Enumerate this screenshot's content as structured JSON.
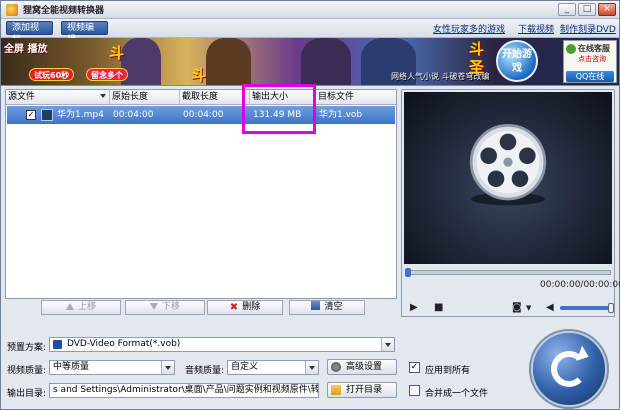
{
  "window": {
    "title": "狸窝全能视频转换器",
    "min_label": "_",
    "max_label": "□",
    "close_label": "×"
  },
  "menu": {
    "add_video": "添加视频",
    "edit_video": "视频编辑",
    "links": [
      "女性玩家多的游戏",
      "下载视频",
      "制作刻录DVD"
    ]
  },
  "banner": {
    "left_text": "全屏 播放",
    "pill1": "试玩60秒",
    "pill2": "留念多个",
    "big1": "斗",
    "big2": "斗",
    "big3": "斗",
    "big3b": "圣",
    "small_text": "网络人气小说 斗破苍穹改编",
    "start_game": "开始游戏",
    "online_title": "在线客服",
    "online_sub": "点击咨询",
    "qq_online": "QQ在线"
  },
  "file_list": {
    "columns": [
      "源文件",
      "原始长度",
      "截取长度",
      "输出大小",
      "目标文件"
    ],
    "rows": [
      {
        "checked": "✓",
        "source": "华为1.mp4",
        "original_length": "00:04:00",
        "cut_length": "00:04:00",
        "output_size": "131.49 MB",
        "target": "华为1.vob"
      }
    ],
    "buttons": {
      "up": "上移",
      "down": "下移",
      "delete": "删除",
      "clear": "清空"
    }
  },
  "preview": {
    "time": "00:00:00/00:00:00"
  },
  "settings": {
    "preset_label": "预置方案:",
    "preset_value": "DVD-Video Format(*.vob)",
    "video_quality_label": "视频质量:",
    "video_quality_value": "中等质量",
    "audio_quality_label": "音频质量:",
    "audio_quality_value": "自定义",
    "advanced_button": "高级设置",
    "apply_all_label": "应用到所有",
    "apply_all_checked": "✓",
    "output_dir_label": "输出目录:",
    "output_dir_value": "s and Settings\\Administrator\\桌面\\产品\\问题实例和视频原件\\转换",
    "open_dir_button": "打开目录",
    "merge_label": "合并成一个文件"
  },
  "colors": {
    "selection": "#3d73c8",
    "highlight_box": "#e000e0",
    "convert_button": "#2f5fa8"
  }
}
